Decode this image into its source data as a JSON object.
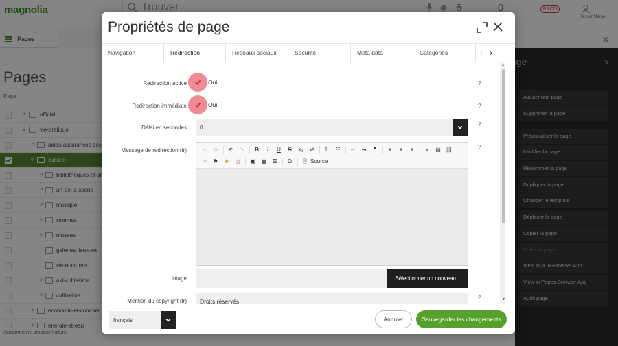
{
  "app": {
    "logo": "magnolia",
    "search_placeholder": "Trouver",
    "prod_badge": "PROD",
    "top_counter": "6",
    "top_counter2": "0",
    "user_label": "Tasser Margot",
    "app_name": "Pages",
    "status_path": "/lausanne/vie-pratique/culture"
  },
  "tree": {
    "title": "Pages",
    "column_header": "Page",
    "rows": [
      {
        "label": "officiel"
      },
      {
        "label": "vie-pratique"
      },
      {
        "label": "aides-assurances-soc"
      },
      {
        "label": "culture"
      },
      {
        "label": "bibliotheques-et-ar"
      },
      {
        "label": "art-de-la-scene"
      },
      {
        "label": "musique"
      },
      {
        "label": "cinemas"
      },
      {
        "label": "musees"
      },
      {
        "label": "galeries-lieux-art"
      },
      {
        "label": "vie-nocturne"
      },
      {
        "label": "old-cultissime"
      },
      {
        "label": "cultissime"
      },
      {
        "label": "economie-et-commer"
      },
      {
        "label": "energie-et-eau"
      }
    ]
  },
  "actions": {
    "header": "age",
    "items": [
      {
        "label": "Ajouter une page"
      },
      {
        "label": "Supprimer la page"
      },
      {
        "label": "Prévisualiser la page"
      },
      {
        "label": "Modifier la page"
      },
      {
        "label": "Renommer la page"
      },
      {
        "label": "Dupliquer la page"
      },
      {
        "label": "Changer le template"
      },
      {
        "label": "Déplacer la page"
      },
      {
        "label": "Copier la page"
      },
      {
        "label": "Coller la page"
      },
      {
        "label": "View in JCR-Browser App"
      },
      {
        "label": "View in Pages-Browser App"
      },
      {
        "label": "Audit page"
      }
    ]
  },
  "dialog": {
    "title": "Propriétés de page",
    "tabs": [
      {
        "label": "Navigation"
      },
      {
        "label": "Redirection"
      },
      {
        "label": "Réseaux sociaux"
      },
      {
        "label": "Securité"
      },
      {
        "label": "Meta data"
      },
      {
        "label": "Catégories"
      }
    ],
    "active_tab": "Redirection",
    "fields": {
      "redirection_active": {
        "label": "Redirection active",
        "value": "Oui"
      },
      "redirection_immediate": {
        "label": "Redirection immédiate",
        "value": "Oui"
      },
      "delai": {
        "label": "Délai en secondes",
        "value": "0"
      },
      "message": {
        "label": "Message de redirection (fr)",
        "source_label": "Source"
      },
      "image": {
        "label": "Image",
        "button": "Sélectionner un nouveau..."
      },
      "copyright": {
        "label": "Mention du copyright (fr)",
        "value": "Droits réservés"
      }
    },
    "help": "?",
    "language": "français",
    "cancel_label": "Annuler",
    "save_label": "Sauvegarder les changements"
  },
  "colors": {
    "accent_green": "#56a12b",
    "checkbox_pink": "#f08a93",
    "selected_tree": "#558b2f"
  }
}
